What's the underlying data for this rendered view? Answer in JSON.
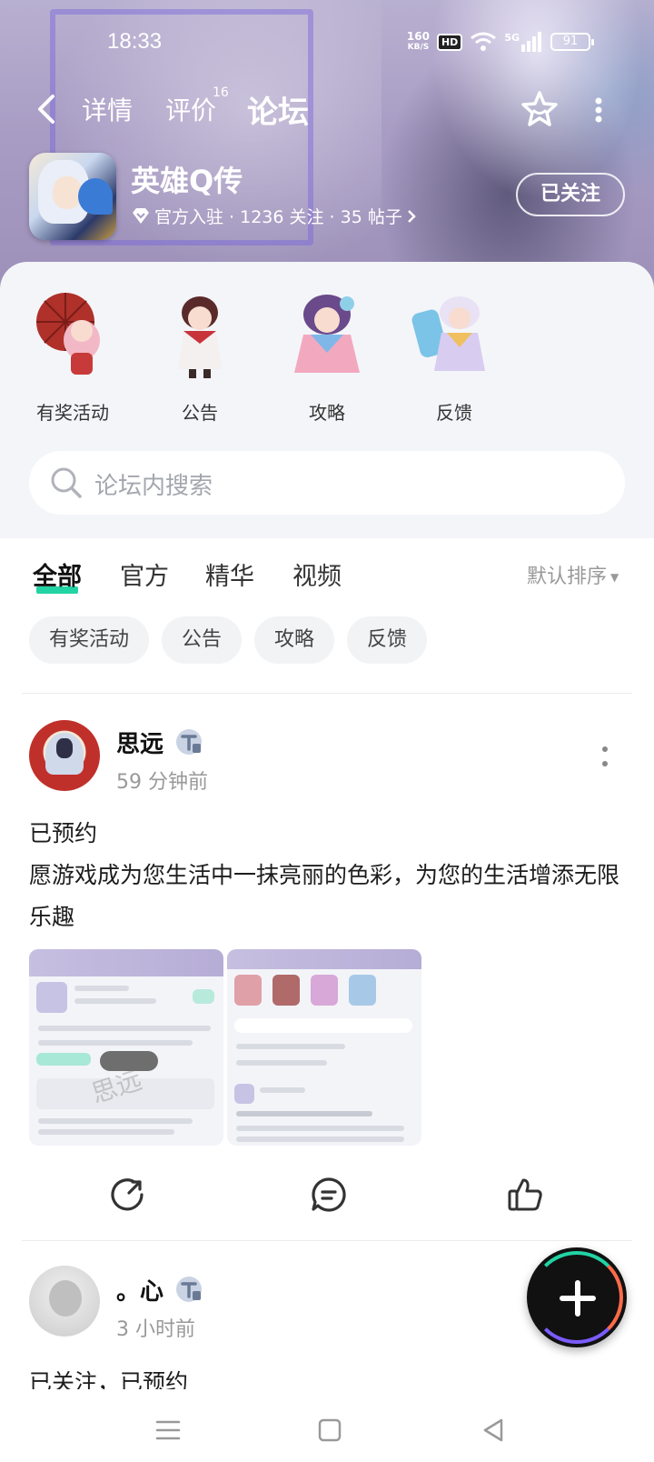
{
  "status_bar": {
    "time": "18:33",
    "net_speed_value": "160",
    "net_speed_unit": "KB/S",
    "hd": "HD",
    "signal": "5G",
    "battery": "91"
  },
  "nav": {
    "tabs": [
      "详情",
      "评价",
      "论坛"
    ],
    "review_count": "16",
    "active_tab": "论坛"
  },
  "game": {
    "title": "英雄Q传",
    "meta": "官方入驻 · 1236 关注 · 35 帖子",
    "follow_label": "已关注"
  },
  "categories": [
    {
      "label": "有奖活动"
    },
    {
      "label": "公告"
    },
    {
      "label": "攻略"
    },
    {
      "label": "反馈"
    }
  ],
  "search": {
    "placeholder": "论坛内搜索"
  },
  "tabs": {
    "all": "全部",
    "official": "官方",
    "featured": "精华",
    "video": "视频",
    "sort": "默认排序"
  },
  "chips": [
    "有奖活动",
    "公告",
    "攻略",
    "反馈"
  ],
  "posts": [
    {
      "user": "思远",
      "time": "59 分钟前",
      "text_line1": "已预约",
      "text_line2": "愿游戏成为您生活中一抹亮丽的色彩，为您的生活增添无限乐趣",
      "watermark": "思远"
    },
    {
      "user": "。心",
      "time": "3 小时前",
      "text_line1": "已关注，已预约"
    }
  ],
  "colors": {
    "accent": "#22d3a4",
    "banner": "#a89cc4",
    "panel": "#f4f5f9",
    "chip_bg": "#f2f3f5"
  },
  "icons": [
    "back-icon",
    "star-icon",
    "more-icon",
    "diamond-icon",
    "chevron-right-icon",
    "search-icon",
    "t-badge-icon",
    "share-icon",
    "comment-icon",
    "like-icon",
    "plus-icon",
    "menu-icon",
    "home-icon",
    "back-triangle-icon"
  ]
}
